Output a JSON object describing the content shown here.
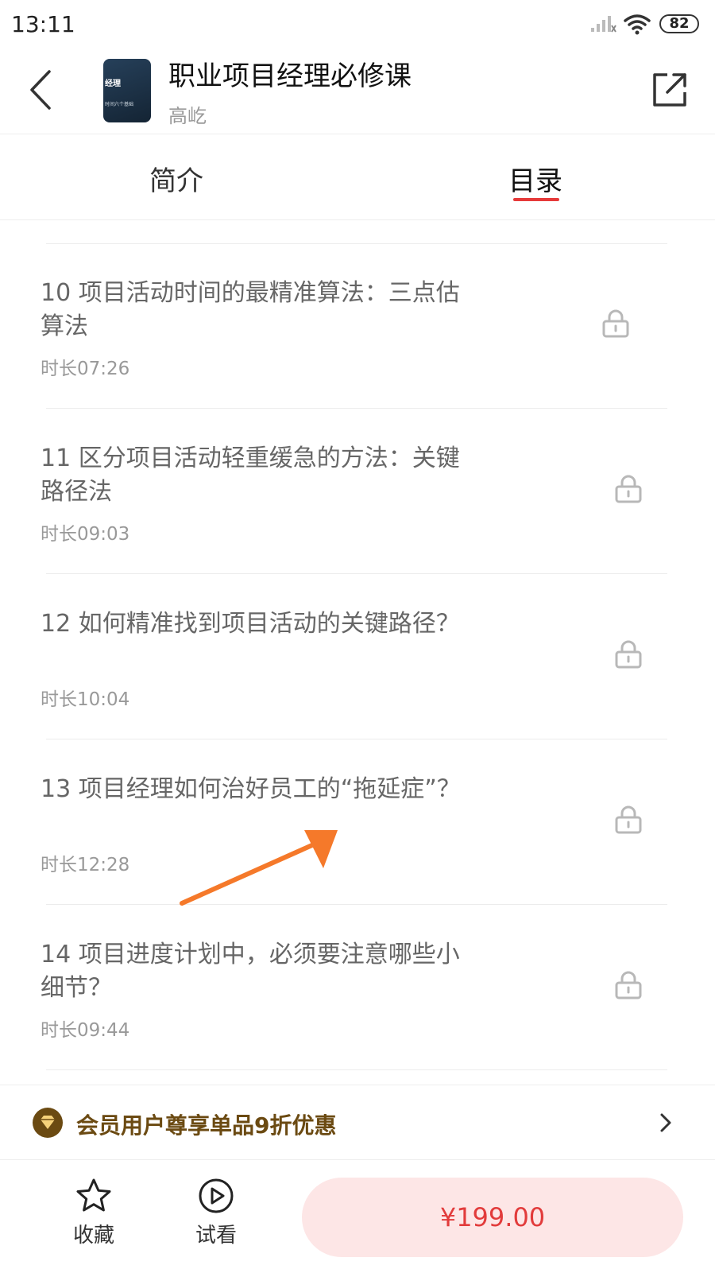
{
  "status_bar": {
    "time": "13:11",
    "battery": "82"
  },
  "header": {
    "title": "职业项目经理必修课",
    "author": "高屹",
    "cover_text": "经理",
    "cover_subtext": "时间六个基础"
  },
  "tabs": [
    {
      "label": "简介",
      "active": false
    },
    {
      "label": "目录",
      "active": true
    }
  ],
  "lessons": [
    {
      "title": "10 项目活动时间的最精准算法：三点估算法",
      "duration": "时长07:26",
      "locked": true
    },
    {
      "title": "11 区分项目活动轻重缓急的方法：关键路径法",
      "duration": "时长09:03",
      "locked": true
    },
    {
      "title": "12 如何精准找到项目活动的关键路径？",
      "duration": "时长10:04",
      "locked": true
    },
    {
      "title": "13 项目经理如何治好员工的“拖延症”？",
      "duration": "时长12:28",
      "locked": true
    },
    {
      "title": "14 项目进度计划中，必须要注意哪些小细节？",
      "duration": "时长09:44",
      "locked": true
    }
  ],
  "promo": {
    "text": "会员用户尊享单品9折优惠"
  },
  "bottom": {
    "favorite_label": "收藏",
    "trial_label": "试看",
    "price": "¥199.00"
  },
  "colors": {
    "accent": "#e63a3a",
    "promo_text": "#6b4a12",
    "buy_bg": "#fde6e6",
    "annotation_arrow": "#f5792a"
  }
}
